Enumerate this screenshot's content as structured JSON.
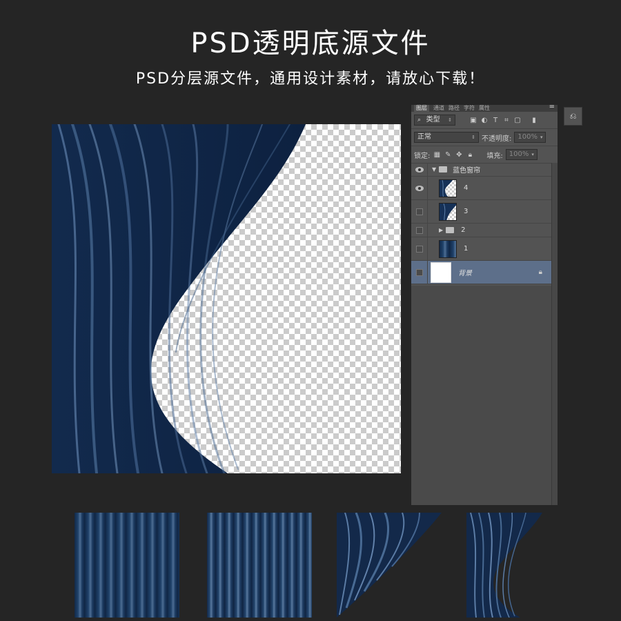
{
  "header": {
    "title": "PSD透明底源文件",
    "subtitle": "PSD分层源文件，通用设计素材，请放心下载！"
  },
  "colors": {
    "background": "#252525",
    "curtain_dark": "#0f2545",
    "curtain_light": "#5a7ba3",
    "panel": "#535353",
    "selected_layer": "#5d6f8a"
  },
  "layers_panel": {
    "tabs": [
      "图层",
      "通道",
      "路径",
      "字符",
      "属性"
    ],
    "menu_icon": "panel-menu-icon",
    "filter_label": "类型",
    "filter_icons": [
      "image-filter-icon",
      "adjustment-filter-icon",
      "type-filter-icon",
      "shape-filter-icon",
      "smart-object-filter-icon"
    ],
    "blend_mode": "正常",
    "opacity_label": "不透明度:",
    "opacity_value": "100%",
    "lock_label": "锁定:",
    "fill_label": "填充:",
    "fill_value": "100%",
    "group": {
      "name": "蓝色窗帘",
      "visible": true,
      "expanded": true
    },
    "layers": [
      {
        "name": "4",
        "visible": true,
        "thumb": "curtain-4"
      },
      {
        "name": "3",
        "visible": false,
        "thumb": "curtain-3"
      },
      {
        "name": "2",
        "visible": false,
        "type": "group"
      },
      {
        "name": "1",
        "visible": false,
        "thumb": "curtain-1"
      },
      {
        "name": "背景",
        "visible": false,
        "thumb": "white",
        "locked": true,
        "selected": true
      }
    ]
  },
  "previews": [
    "straight-stripes",
    "straight-stripes-dense",
    "corner-drape",
    "s-curve-drape"
  ]
}
